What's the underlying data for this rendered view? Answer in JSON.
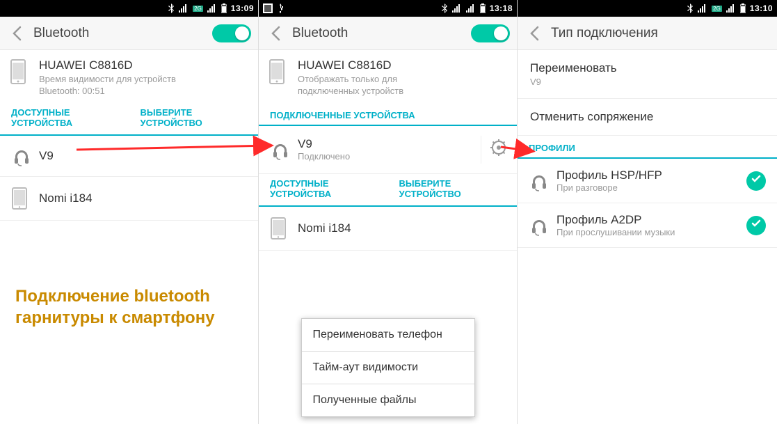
{
  "screens": [
    {
      "statusbar": {
        "time": "13:09"
      },
      "header": {
        "title": "Bluetooth",
        "toggle_on": true
      },
      "device": {
        "name": "HUAWEI C8816D",
        "sub": "Время видимости для устройств",
        "sub2": "Bluetooth: 00:51"
      },
      "tabs": {
        "left": "ДОСТУПНЫЕ\nУСТРОЙСТВА",
        "right": "ВЫБЕРИТЕ\nУСТРОЙСТВО"
      },
      "items": [
        {
          "label": "V9",
          "icon": "headset"
        },
        {
          "label": "Nomi i184",
          "icon": "phone"
        }
      ]
    },
    {
      "statusbar": {
        "time": "13:18"
      },
      "header": {
        "title": "Bluetooth",
        "toggle_on": true
      },
      "device": {
        "name": "HUAWEI C8816D",
        "sub": "Отображать только для",
        "sub2": "подключенных устройств"
      },
      "section_connected": "ПОДКЛЮЧЕННЫЕ УСТРОЙСТВА",
      "connected_item": {
        "label": "V9",
        "sublabel": "Подключено"
      },
      "tabs": {
        "left": "ДОСТУПНЫЕ\nУСТРОЙСТВА",
        "right": "ВЫБЕРИТЕ\nУСТРОЙСТВО"
      },
      "items": [
        {
          "label": "Nomi i184",
          "icon": "phone"
        }
      ],
      "menu": [
        "Переименовать телефон",
        "Тайм-аут видимости",
        "Полученные файлы"
      ]
    },
    {
      "statusbar": {
        "time": "13:10"
      },
      "header": {
        "title": "Тип подключения"
      },
      "rename": {
        "label": "Переименовать",
        "value": "V9"
      },
      "unpair": "Отменить сопряжение",
      "section_profiles": "ПРОФИЛИ",
      "profiles": [
        {
          "label": "Профиль HSP/HFP",
          "sublabel": "При разговоре"
        },
        {
          "label": "Профиль A2DP",
          "sublabel": "При прослушивании музыки"
        }
      ]
    }
  ],
  "caption": "Подключение bluetooth\nгарнитуры к смартфону"
}
